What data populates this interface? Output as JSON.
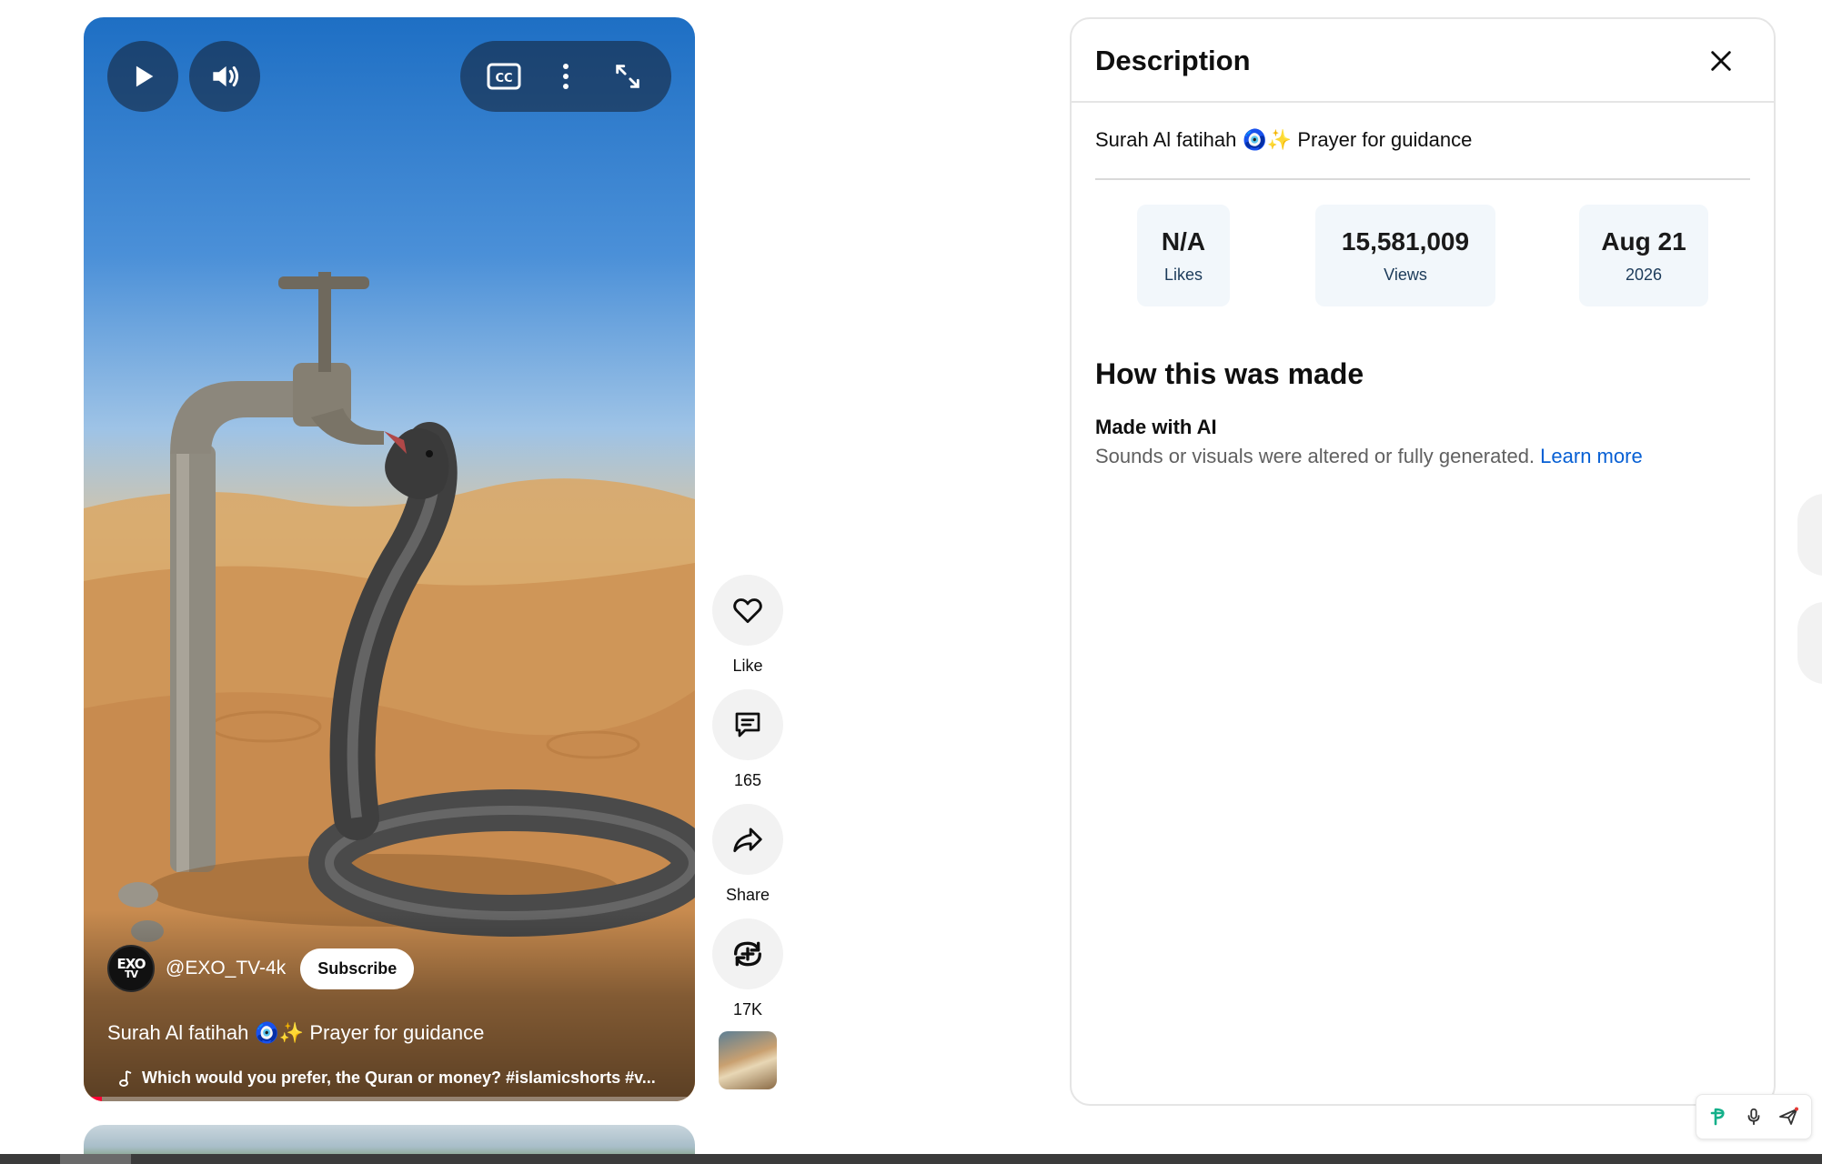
{
  "player": {
    "play_icon": "play-icon",
    "volume_icon": "volume-icon",
    "captions_label": "CC",
    "more_icon": "more-vert-icon",
    "fullscreen_icon": "fullscreen-icon",
    "channel": {
      "avatar_line1": "EXO",
      "avatar_line2": "TV",
      "handle": "@EXO_TV-4k",
      "subscribe_label": "Subscribe"
    },
    "title": "Surah Al fatihah 🧿✨ Prayer for guidance",
    "music_text": "Which would you prefer, the Quran or money? #islamicshorts #v...",
    "progress_fraction": 0.03,
    "progress_color": "#ff0033"
  },
  "actions": {
    "like_label": "Like",
    "comments_count": "165",
    "share_label": "Share",
    "remix_count": "17K"
  },
  "description_panel": {
    "title": "Description",
    "text": "Surah Al fatihah 🧿✨ Prayer for guidance",
    "stats": [
      {
        "value": "N/A",
        "label": "Likes"
      },
      {
        "value": "15,581,009",
        "label": "Views"
      },
      {
        "value": "Aug 21",
        "label": "2026"
      }
    ],
    "how_made_title": "How this was made",
    "made_with": "Made with AI",
    "made_desc": "Sounds or visuals were altered or fully generated.",
    "learn_more": "Learn more",
    "link_color": "#065fd4"
  }
}
